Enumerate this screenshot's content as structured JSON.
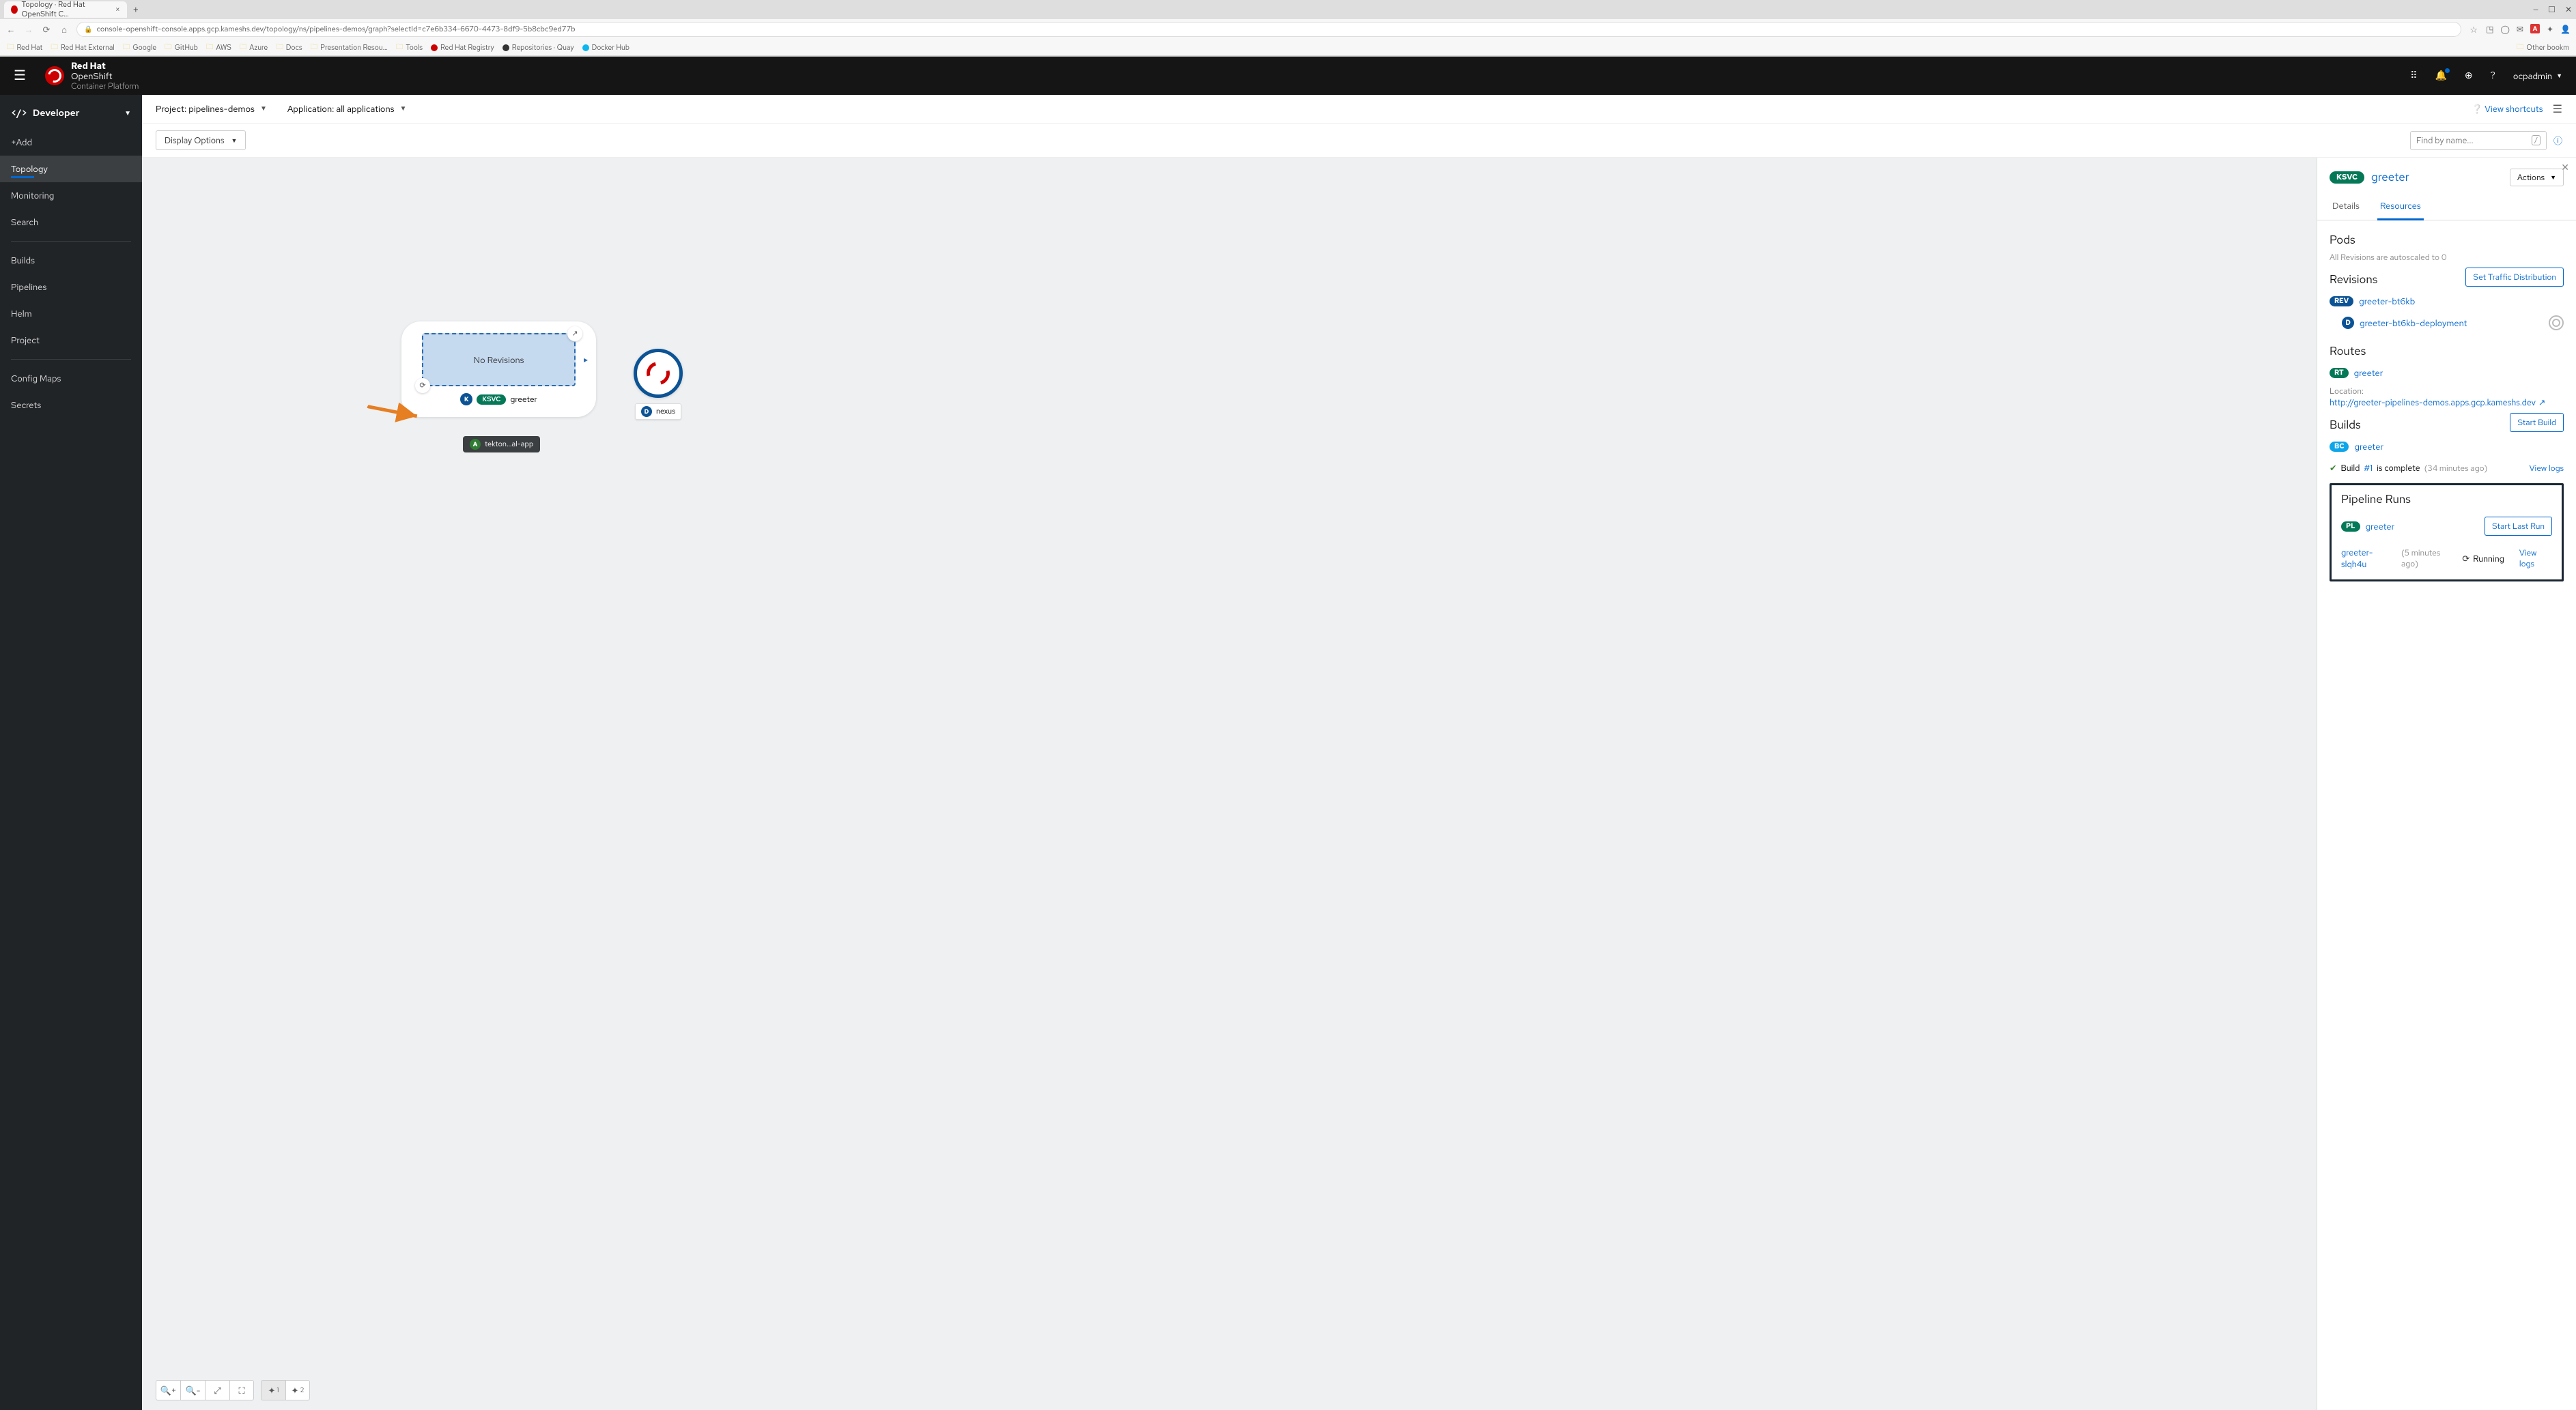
{
  "browser": {
    "tab_title": "Topology · Red Hat OpenShift C…",
    "url": "console-openshift-console.apps.gcp.kameshs.dev/topology/ns/pipelines-demos/graph?selectId=c7e6b334-6670-4473-8df9-5b8cbc9ed77b",
    "bookmarks": [
      "Red Hat",
      "Red Hat External",
      "Google",
      "GitHub",
      "AWS",
      "Azure",
      "Docs",
      "Presentation Resou…",
      "Tools",
      "Red Hat Registry",
      "Repositories · Quay",
      "Docker Hub"
    ],
    "other_bookmarks": "Other bookm"
  },
  "masthead": {
    "brand1": "Red Hat",
    "brand2": "OpenShift",
    "brand3": "Container Platform",
    "user": "ocpadmin"
  },
  "leftnav": {
    "perspective": "Developer",
    "items": [
      "+Add",
      "Topology",
      "Monitoring",
      "Search",
      "Builds",
      "Pipelines",
      "Helm",
      "Project",
      "Config Maps",
      "Secrets"
    ],
    "active": "Topology"
  },
  "contentHeader": {
    "project_label": "Project: pipelines-demos",
    "app_label": "Application: all applications",
    "view_shortcuts": "View shortcuts"
  },
  "toolbar": {
    "display_options": "Display Options",
    "find_placeholder": "Find by name..."
  },
  "canvas": {
    "ksvc_norev": "No Revisions",
    "ksvc_badge": "KSVC",
    "ksvc_name": "greeter",
    "app_label": "tekton…al-app",
    "nexus_label": "nexus",
    "controls": {
      "layout1": "1",
      "layout2": "2"
    }
  },
  "sidepanel": {
    "kind_badge": "KSVC",
    "title": "greeter",
    "actions": "Actions",
    "tabs": {
      "details": "Details",
      "resources": "Resources"
    },
    "pods": {
      "title": "Pods",
      "note": "All Revisions are autoscaled to 0"
    },
    "revisions": {
      "title": "Revisions",
      "button": "Set Traffic Distribution",
      "rev_name": "greeter-bt6kb",
      "dep_name": "greeter-bt6kb-deployment"
    },
    "routes": {
      "title": "Routes",
      "rt_name": "greeter",
      "loc_label": "Location:",
      "loc_url": "http://greeter-pipelines-demos.apps.gcp.kameshs.dev"
    },
    "builds": {
      "title": "Builds",
      "bc_name": "greeter",
      "start_build": "Start Build",
      "status_prefix": "Build",
      "build_num": "#1",
      "status_suffix": "is complete",
      "age": "(34 minutes ago)",
      "view_logs": "View logs"
    },
    "pipelines": {
      "title": "Pipeline Runs",
      "pl_name": "greeter",
      "start_last": "Start Last Run",
      "run_name": "greeter-slqh4u",
      "run_age": "(5 minutes ago)",
      "run_status": "Running",
      "view_logs": "View logs"
    }
  }
}
